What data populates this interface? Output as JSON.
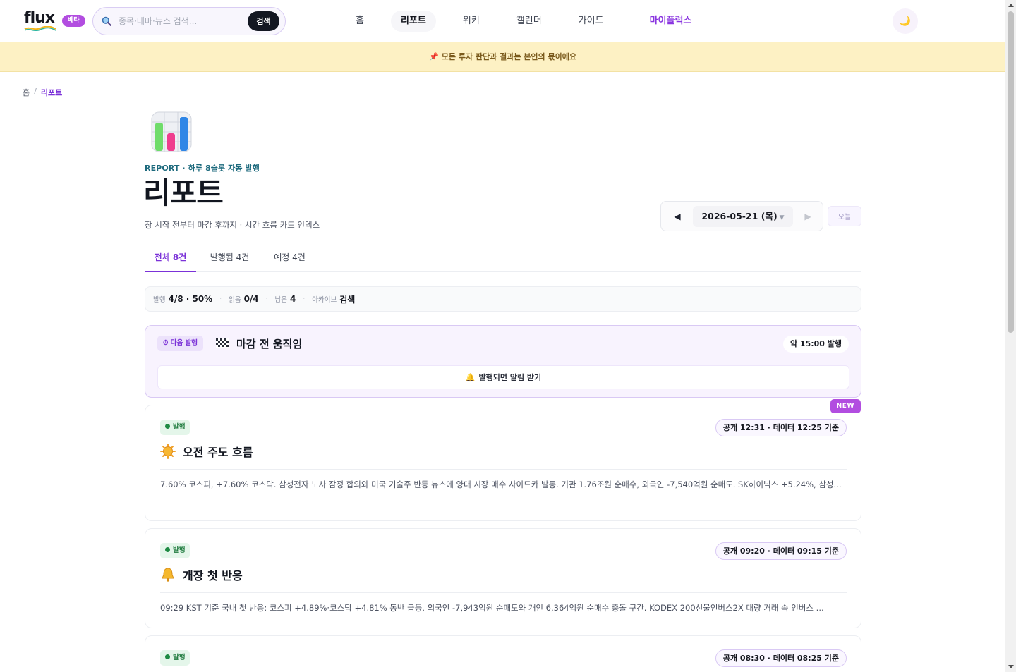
{
  "nav": {
    "logo_text": "flux",
    "beta_label": "베타",
    "search_placeholder": "종목·테마·뉴스 검색...",
    "search_button": "검색",
    "links": [
      {
        "label": "홈"
      },
      {
        "label": "리포트"
      },
      {
        "label": "위키"
      },
      {
        "label": "캘린더"
      },
      {
        "label": "가이드"
      }
    ],
    "brand_link": "마이플럭스",
    "theme_icon": "moon-icon",
    "theme_glyph": "🌙"
  },
  "banner": {
    "icon": "pin-icon",
    "glyph": "📌",
    "text": "모든 투자 판단과 결과는 본인의 몫이에요"
  },
  "breadcrumb": {
    "home": "홈",
    "separator": "/",
    "current": "리포트"
  },
  "hero": {
    "icon": "bar-chart-icon",
    "eyebrow": "REPORT · 하루 8슬롯 자동 발행",
    "title": "리포트",
    "subtitle": "장 시작 전부터 마감 후까지 · 시간 흐름 카드 인덱스"
  },
  "date_nav": {
    "prev_glyph": "◀",
    "date": "2026-05-21 (목)",
    "caret": "▼",
    "next_glyph": "▶",
    "today_label": "오늘"
  },
  "tabs": [
    {
      "label": "전체 8건"
    },
    {
      "label": "발행됨 4건"
    },
    {
      "label": "예정 4건"
    }
  ],
  "stats": {
    "published_label": "발행",
    "published_value": "4/8 · 50%",
    "read_label": "읽음",
    "read_value": "0/4",
    "remaining_label": "남은",
    "remaining_value": "4",
    "archive_label": "아카이브",
    "archive_link": "검색",
    "dot": "·"
  },
  "next_slot": {
    "badge": "⏱ 다음 발행",
    "icon": "checkered-flag-icon",
    "title": "마감 전 움직임",
    "eta": "약 15:00 발행",
    "notify_glyph": "🔔",
    "notify_label": "발행되면 알림 받기"
  },
  "reports": [
    {
      "status": "발행",
      "time_label": "공개 12:31 · 데이터 12:25 기준",
      "icon": "sun-icon",
      "title": "오전 주도 흐름",
      "summary": "7.60% 코스피, +7.60% 코스닥. 삼성전자 노사 잠정 합의와 미국 기술주 반등 뉴스에 양대 시장 매수 사이드카 발동. 기관 1.76조원 순매수, 외국인 -7,540억원 순매도. SK하이닉스 +5.24%, 삼성...",
      "new_label": "NEW"
    },
    {
      "status": "발행",
      "time_label": "공개 09:20 · 데이터 09:15 기준",
      "icon": "bell-icon",
      "title": "개장 첫 반응",
      "summary": "09:29 KST 기준 국내 첫 반응: 코스피 +4.89%·코스닥 +4.81% 동반 급등, 외국인 -7,943억원 순매도와 개인 6,364억원 순매수 충돌 구간. KODEX 200선물인버스2X 대량 거래 속 인버스 ..."
    },
    {
      "status": "발행",
      "time_label": "공개 08:30 · 데이터 08:25 기준"
    }
  ],
  "colors": {
    "accent": "#7b32d8",
    "beta": "#b24de0",
    "banner_bg": "#fdf1c4",
    "published_green": "#1e8a43"
  }
}
